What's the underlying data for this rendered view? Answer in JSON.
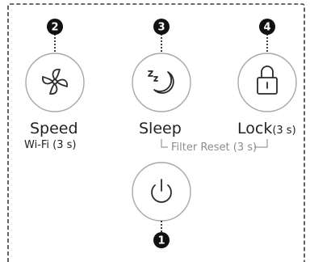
{
  "panel": {
    "colors": {
      "border": "#3c3c3c",
      "circle_stroke": "#a8a8a8",
      "icon_stroke": "#2a2a2a",
      "marker_fill": "#111111",
      "marker_text": "#ffffff",
      "bracket": "#9a9a9a",
      "sub_label": "#8c8c8c"
    },
    "buttons": [
      {
        "id": "speed",
        "icon": "fan-icon",
        "label": "Speed",
        "sublabel": "Wi-Fi (3 s)",
        "marker": "2"
      },
      {
        "id": "sleep",
        "icon": "sleep-moon-icon",
        "label": "Sleep",
        "marker": "3"
      },
      {
        "id": "lock",
        "icon": "padlock-icon",
        "label": "Lock",
        "label_suffix": "(3 s)",
        "marker": "4"
      },
      {
        "id": "power",
        "icon": "power-icon",
        "marker": "1"
      }
    ],
    "filter_reset_label": "Filter Reset (3 s)"
  }
}
